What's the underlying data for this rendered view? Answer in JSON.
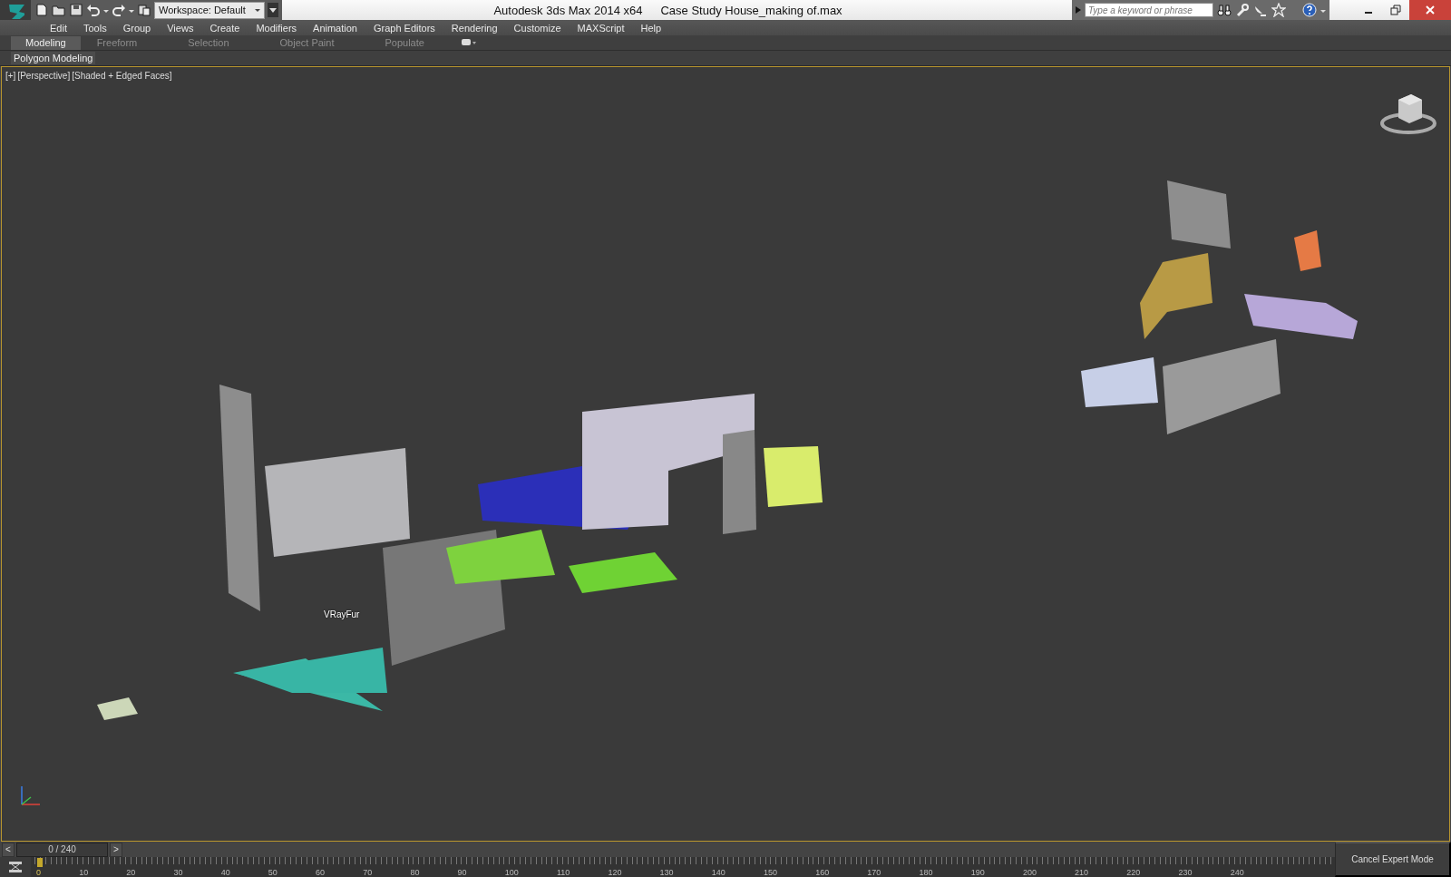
{
  "title_bar": {
    "workspace": "Workspace: Default",
    "app_title": "Autodesk 3ds Max  2014 x64",
    "file_name": "Case Study House_making of.max",
    "search": {
      "placeholder": "Type a keyword or phrase"
    }
  },
  "menu": [
    "Edit",
    "Tools",
    "Group",
    "Views",
    "Create",
    "Modifiers",
    "Animation",
    "Graph Editors",
    "Rendering",
    "Customize",
    "MAXScript",
    "Help"
  ],
  "ribbon_tabs": [
    {
      "label": "Modeling",
      "selected": true
    },
    {
      "label": "Freeform",
      "selected": false
    },
    {
      "label": "Selection",
      "selected": false
    },
    {
      "label": "Object Paint",
      "selected": false
    },
    {
      "label": "Populate",
      "selected": false
    }
  ],
  "ribbon_panel": "Polygon Modeling",
  "viewport": {
    "labels": [
      "[+]",
      "[Perspective]",
      "[Shaded + Edged Faces]"
    ],
    "object_label": "VRayFur"
  },
  "time_slider": {
    "prev": "<",
    "frame": "0 / 240",
    "next": ">"
  },
  "track_bar": {
    "ticks": [
      "0",
      "10",
      "20",
      "30",
      "40",
      "50",
      "60",
      "70",
      "80",
      "90",
      "100",
      "110",
      "120",
      "130",
      "140",
      "150",
      "160",
      "170",
      "180",
      "190",
      "200",
      "210",
      "220",
      "230",
      "240"
    ]
  },
  "status": {
    "button": "Cancel Expert Mode"
  }
}
